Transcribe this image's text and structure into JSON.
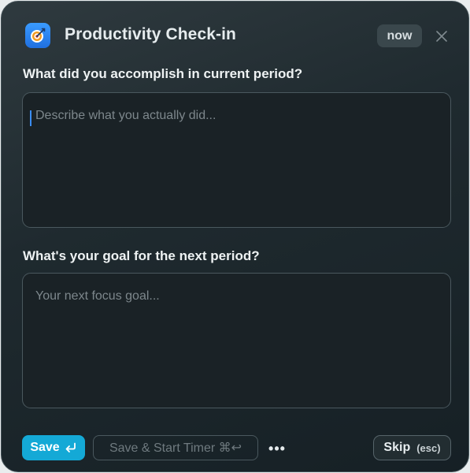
{
  "header": {
    "app_icon": "target-pencil-icon",
    "title": "Productivity Check-in",
    "time_badge": "now",
    "close_icon": "close-icon"
  },
  "questions": [
    {
      "label": "What did you accomplish in current period?",
      "placeholder": "Describe what you actually did...",
      "value": ""
    },
    {
      "label": "What's your goal for the next period?",
      "placeholder": "Your next focus goal...",
      "value": ""
    }
  ],
  "footer": {
    "save_label": "Save",
    "save_icon": "return-key-icon",
    "save_timer_label": "Save & Start Timer ⌘↩",
    "more_label": "•••",
    "skip_label": "Skip",
    "skip_hint": "(esc)"
  },
  "colors": {
    "accent": "#14a9d6",
    "background": "#1f2a2f",
    "app_icon": "#2a86f0",
    "caret": "#3a8df5"
  }
}
